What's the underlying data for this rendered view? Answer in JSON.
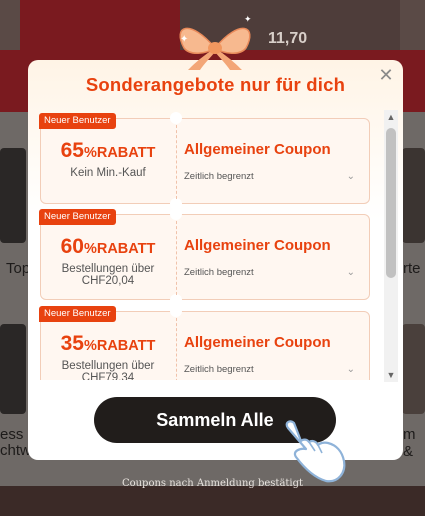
{
  "background": {
    "price_fragment": "11,70",
    "left_text": "Top",
    "right_text": "rte",
    "bottom_left_lines": [
      "ess",
      "chtw"
    ],
    "bottom_right_text": "m &"
  },
  "modal": {
    "title": "Sonderangebote nur für dich",
    "close_icon": "close-icon",
    "coupons": [
      {
        "badge": "Neuer Benutzer",
        "percent": "65",
        "discount_label": "%RABATT",
        "condition": "Kein Min.-Kauf",
        "type": "Allgemeiner Coupon",
        "validity": "Zeitlich begrenzt"
      },
      {
        "badge": "Neuer Benutzer",
        "percent": "60",
        "discount_label": "%RABATT",
        "condition": "Bestellungen über CHF20,04",
        "type": "Allgemeiner Coupon",
        "validity": "Zeitlich begrenzt"
      },
      {
        "badge": "Neuer Benutzer",
        "percent": "35",
        "discount_label": "%RABATT",
        "condition": "Bestellungen über CHF79,34",
        "type": "Allgemeiner Coupon",
        "validity": "Zeitlich begrenzt"
      }
    ],
    "collect_button": "Sammeln Alle"
  },
  "footer_note": "Coupons nach Anmeldung bestätigt",
  "colors": {
    "accent": "#e8420f",
    "button": "#211d1b"
  }
}
